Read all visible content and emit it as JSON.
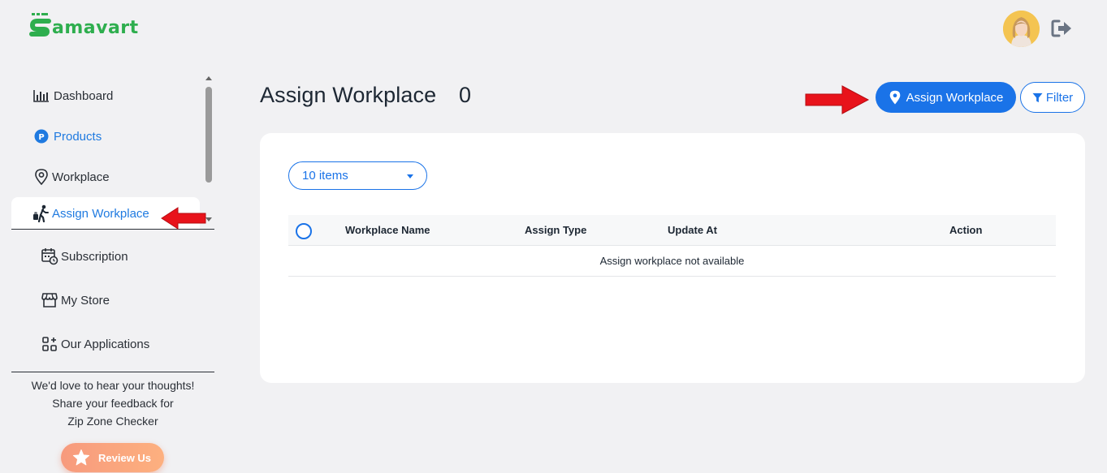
{
  "brand": {
    "logo_text": "amavart",
    "color": "#2eae4e"
  },
  "header": {
    "avatar": "user-avatar",
    "logout_icon": "logout-icon"
  },
  "sidebar": {
    "items": [
      {
        "label": "Dashboard",
        "icon": "bar-chart-icon"
      },
      {
        "label": "Products",
        "icon": "product-p-icon"
      },
      {
        "label": "Workplace",
        "icon": "location-pin-icon"
      },
      {
        "label": "Assign Workplace",
        "icon": "walking-luggage-icon",
        "active": true
      }
    ],
    "items2": [
      {
        "label": "Subscription",
        "icon": "calendar-clock-icon"
      },
      {
        "label": "My Store",
        "icon": "store-icon"
      },
      {
        "label": "Our Applications",
        "icon": "apps-grid-icon"
      }
    ],
    "feedback": {
      "line1": "We'd love to hear your thoughts!",
      "line2": "Share your feedback for",
      "line3": "Zip Zone Checker"
    },
    "review_label": "Review Us"
  },
  "main": {
    "title": "Assign Workplace",
    "count": "0",
    "assign_button": "Assign Workplace",
    "filter_button": "Filter",
    "page_size": "10 items",
    "table": {
      "columns": [
        "Workplace Name",
        "Assign Type",
        "Update At",
        "Action"
      ],
      "empty_message": "Assign workplace not available"
    }
  },
  "colors": {
    "accent": "#1a73e8",
    "arrow": "#e8131b",
    "review_gradient_start": "#f79a7d",
    "review_gradient_end": "#fdb07f"
  }
}
